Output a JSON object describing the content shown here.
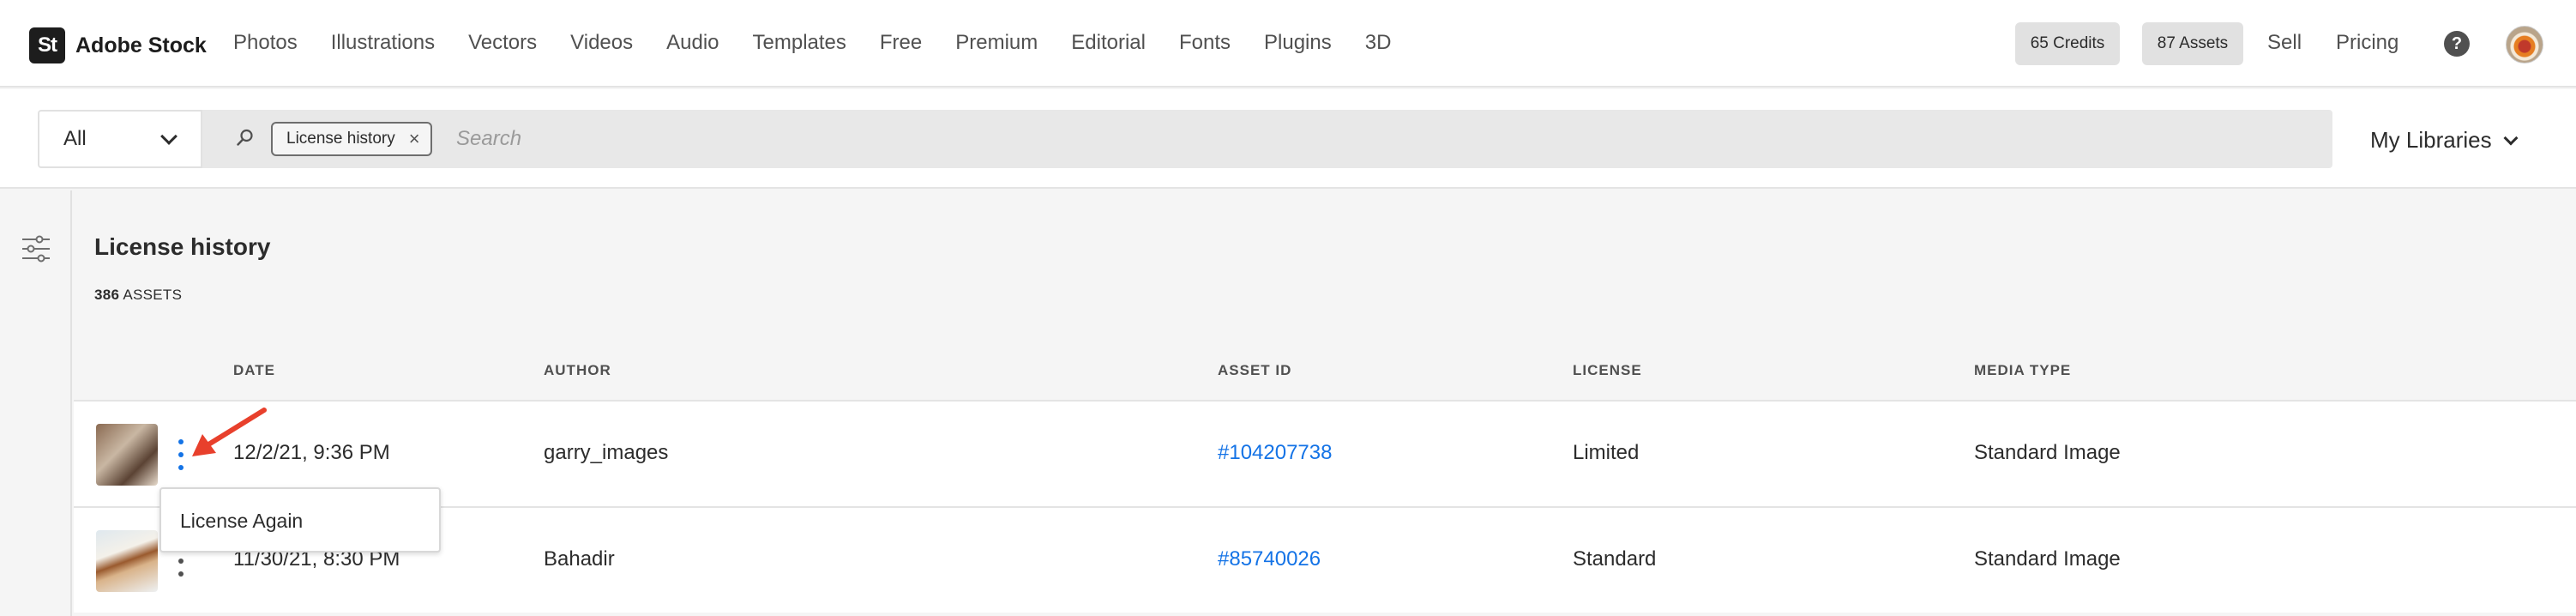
{
  "brand": {
    "logo_mark": "St",
    "name": "Adobe Stock"
  },
  "nav": {
    "links": [
      "Photos",
      "Illustrations",
      "Vectors",
      "Videos",
      "Audio",
      "Templates",
      "Free",
      "Premium",
      "Editorial",
      "Fonts",
      "Plugins",
      "3D"
    ],
    "credits": "65 Credits",
    "assets": "87 Assets",
    "sell": "Sell",
    "pricing": "Pricing",
    "help_icon": "?"
  },
  "search": {
    "filter_value": "All",
    "chip_label": "License history",
    "chip_remove": "×",
    "placeholder": "Search",
    "my_libraries": "My Libraries"
  },
  "page": {
    "title": "License history",
    "asset_count": "386",
    "asset_count_suffix": "ASSETS"
  },
  "table": {
    "columns": [
      "DATE",
      "AUTHOR",
      "ASSET ID",
      "LICENSE",
      "MEDIA TYPE"
    ],
    "rows": [
      {
        "date": "12/2/21, 9:36 PM",
        "author": "garry_images",
        "asset_id": "#104207738",
        "license": "Limited",
        "media_type": "Standard Image"
      },
      {
        "date": "11/30/21, 8:30 PM",
        "author": "Bahadir",
        "asset_id": "#85740026",
        "license": "Standard",
        "media_type": "Standard Image"
      }
    ]
  },
  "context_menu": {
    "item": "License Again"
  },
  "colors": {
    "accent": "#1473e6",
    "arrow": "#e8402c"
  }
}
